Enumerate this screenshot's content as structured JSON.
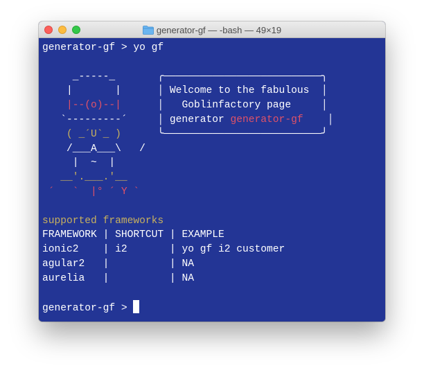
{
  "window": {
    "title": "generator-gf — -bash — 49×19",
    "folder_icon": "folder-icon",
    "traffic_lights": [
      "close-button",
      "minimize-button",
      "zoom-button"
    ]
  },
  "colors": {
    "background": "#233595",
    "text": "#ffffff",
    "yellow": "#c8b15e",
    "red": "#e05268"
  },
  "terminal": {
    "prompt_line": "generator-gf > yo gf",
    "art": [
      "     _-----_     ",
      "    |       |    ",
      "    |--(o)--|    ",
      "   `---------´   ",
      "    ( _´U`_ )    ",
      "    /___A___\\   /",
      "     |  ~  |     ",
      "   __'.___.'__   ",
      " ´   `  |° ´ Y ` "
    ],
    "welcome_box": {
      "top": "╭──────────────────────────╮",
      "line1": "Welcome to the fabulous",
      "line2": "Goblinfactory page",
      "line3_prefix": "generator ",
      "line3_highlight": "generator-gf",
      "bottom": "╰──────────────────────────╯"
    },
    "supported_title": "supported frameworks",
    "table": {
      "headers": [
        "FRAMEWORK",
        "SHORTCUT",
        "EXAMPLE"
      ],
      "rows": [
        [
          "ionic2",
          "i2",
          "yo gf i2 customer"
        ],
        [
          "agular2",
          "",
          "NA"
        ],
        [
          "aurelia",
          "",
          "NA"
        ]
      ]
    },
    "final_prompt": "generator-gf > "
  }
}
